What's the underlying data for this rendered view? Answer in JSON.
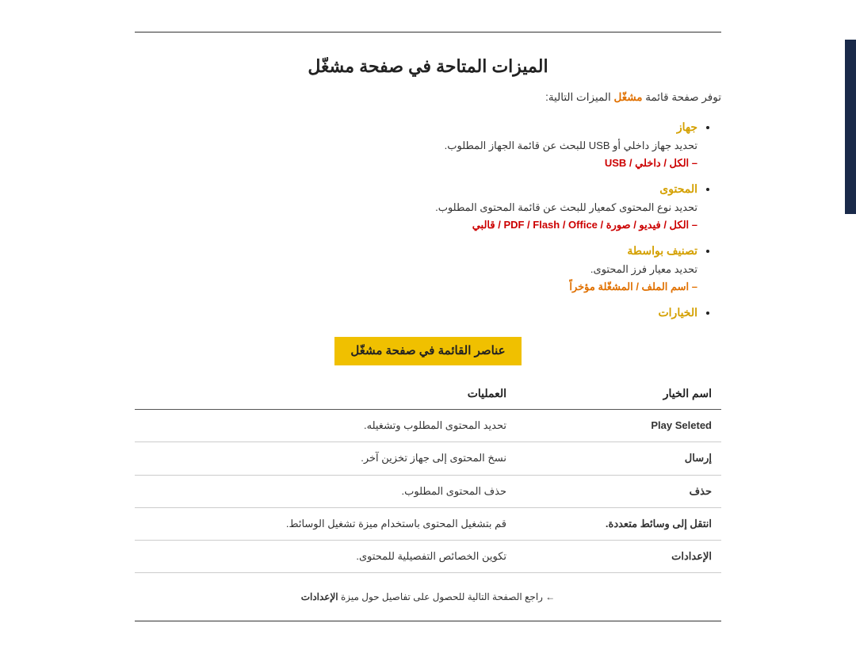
{
  "page": {
    "title": "الميزات المتاحة في صفحة مشغّل",
    "intro": {
      "text": "توفر صفحة قائمة",
      "highlight": "مشغّل",
      "text2": "الميزات التالية:"
    },
    "features": [
      {
        "title": "جهاز",
        "desc": "تحديد جهاز داخلي أو USB للبحث عن قائمة الجهاز المطلوب.",
        "sub_prefix": "– الكل / داخلي / USB",
        "sub_text": "",
        "sub_type": "red"
      },
      {
        "title": "المحتوى",
        "desc": "تحديد نوع المحتوى كمعيار للبحث عن قائمة المحتوى المطلوب.",
        "sub_prefix": "– الكل / فيديو / صورة / PDF / Flash / Office / قالبي",
        "sub_text": "",
        "sub_type": "red"
      },
      {
        "title": "تصنيف بواسطة",
        "desc": "تحديد معيار فرز المحتوى.",
        "sub_prefix": "– اسم الملف / المشغّلة مؤخراً",
        "sub_text": "",
        "sub_type": "orange"
      },
      {
        "title": "الخيارات",
        "desc": "",
        "sub_prefix": "",
        "sub_text": "",
        "sub_type": ""
      }
    ],
    "section_heading": "عناصر القائمة في صفحة مشغّل",
    "table": {
      "col_name": "اسم الخيار",
      "col_ops": "العمليات",
      "rows": [
        {
          "name": "Play Seleted",
          "name_type": "normal",
          "ops": "تحديد المحتوى المطلوب وتشغيله."
        },
        {
          "name": "إرسال",
          "name_type": "red",
          "ops": "نسخ المحتوى إلى جهاز تخزين آخر."
        },
        {
          "name": "حذف",
          "name_type": "red",
          "ops": "حذف المحتوى المطلوب."
        },
        {
          "name": "انتقل إلى وسائط متعددة.",
          "name_type": "orange",
          "ops": "قم بتشغيل المحتوى باستخدام ميزة تشغيل الوسائط."
        },
        {
          "name": "الإعدادات",
          "name_type": "orange",
          "ops": "تكوين الخصائص التفصيلية للمحتوى."
        }
      ]
    },
    "bottom_ref": "← راجع الصفحة التالية للحصول على تفاصيل حول ميزة الإعدادات"
  }
}
